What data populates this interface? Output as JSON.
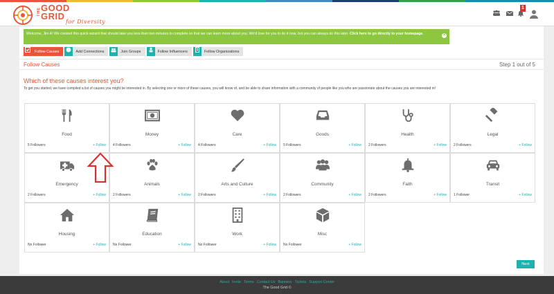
{
  "header": {
    "logo": {
      "the": "THE",
      "good": "GOOD",
      "grid": "GRID",
      "sub": "for Diversity"
    },
    "icons": [
      "group-icon",
      "mail-icon",
      "bell-icon",
      "user-icon"
    ],
    "notification_count": "1"
  },
  "welcome": {
    "text": "Welcome, Jim A! We created this quick wizard that should take you less than two minutes to complete so that we can learn more about you. We'd love for you to do it now, but you can always do this later.",
    "link": "Click here to go directly to your homepage."
  },
  "steps": [
    {
      "label": "Follow Causes",
      "icon": "check-square-icon",
      "active": true
    },
    {
      "label": "Add Connections",
      "icon": "globe-icon",
      "active": false
    },
    {
      "label": "Join Groups",
      "icon": "users-icon",
      "active": false
    },
    {
      "label": "Follow Influencers",
      "icon": "person-icon",
      "active": false
    },
    {
      "label": "Follow Organizations",
      "icon": "building-icon",
      "active": false
    }
  ],
  "section": {
    "title": "Follow Causes",
    "step_text": "Step 1 out of 5"
  },
  "question": "Which of these causes interest you?",
  "intro": "To get you started, we have compiled a list of causes you might be interested in. By selecting one or more of these causes, you will know of, and be able to share information with a community of people like you who are passionate about the causes you are interested in!",
  "causes": [
    {
      "name": "Food",
      "followers": "5 Followers",
      "follow": "+ Follow",
      "icon": "fork-knife-icon"
    },
    {
      "name": "Money",
      "followers": "4 Followers",
      "follow": "+ Follow",
      "icon": "money-icon"
    },
    {
      "name": "Care",
      "followers": "4 Followers",
      "follow": "+ Follow",
      "icon": "heart-icon"
    },
    {
      "name": "Goods",
      "followers": "5 Followers",
      "follow": "+ Follow",
      "icon": "inbox-icon"
    },
    {
      "name": "Health",
      "followers": "2 Followers",
      "follow": "+ Follow",
      "icon": "stethoscope-icon"
    },
    {
      "name": "Legal",
      "followers": "2 Followers",
      "follow": "+ Follow",
      "icon": "gavel-icon"
    },
    {
      "name": "Emergency",
      "followers": "2 Followers",
      "follow": "+ Follow",
      "icon": "ambulance-icon"
    },
    {
      "name": "Animals",
      "followers": "2 Followers",
      "follow": "+ Follow",
      "icon": "paw-icon"
    },
    {
      "name": "Arts and Culture",
      "followers": "2 Followers",
      "follow": "+ Follow",
      "icon": "paintbrush-icon"
    },
    {
      "name": "Community",
      "followers": "2 Followers",
      "follow": "+ Follow",
      "icon": "users-icon"
    },
    {
      "name": "Faith",
      "followers": "2 Followers",
      "follow": "+ Follow",
      "icon": "bell-icon"
    },
    {
      "name": "Transit",
      "followers": "1 Follower",
      "follow": "+ Follow",
      "icon": "car-icon"
    },
    {
      "name": "Housing",
      "followers": "No Follower",
      "follow": "+ Follow",
      "icon": "home-icon"
    },
    {
      "name": "Education",
      "followers": "No Follower",
      "follow": "+ Follow",
      "icon": "book-icon"
    },
    {
      "name": "Work",
      "followers": "No Follower",
      "follow": "+ Follow",
      "icon": "building-icon"
    },
    {
      "name": "Misc",
      "followers": "No Follower",
      "follow": "+ Follow",
      "icon": "cube-icon"
    }
  ],
  "next_label": "Next",
  "footer": {
    "links": [
      "About",
      "Invite",
      "Terms",
      "Contact Us",
      "Banners",
      "Tickets",
      "Support Center"
    ],
    "copyright": "The Good Grid ©"
  },
  "colors": {
    "accent": "#e8563a",
    "teal": "#1fb1ad",
    "green": "#8dc63f",
    "icon_gray": "#6d6d6d"
  }
}
